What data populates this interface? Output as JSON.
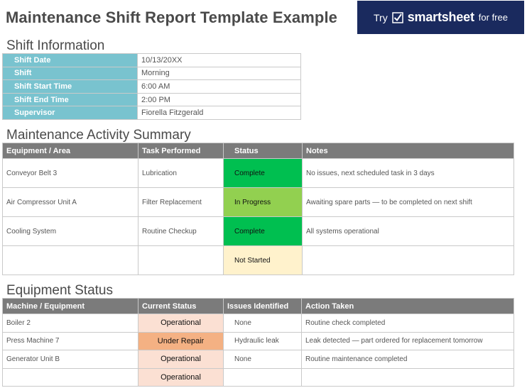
{
  "header": {
    "title": "Maintenance Shift Report Template Example",
    "promo_try": "Try",
    "promo_brand": "smartsheet",
    "promo_free": "for free"
  },
  "shift_info": {
    "heading": "Shift Information",
    "rows": [
      {
        "label": "Shift Date",
        "value": "10/13/20XX"
      },
      {
        "label": "Shift",
        "value": "Morning"
      },
      {
        "label": "Shift Start Time",
        "value": "6:00 AM"
      },
      {
        "label": "Shift End Time",
        "value": "2:00 PM"
      },
      {
        "label": "Supervisor",
        "value": "Fiorella Fitzgerald"
      }
    ]
  },
  "activity": {
    "heading": "Maintenance Activity Summary",
    "columns": [
      "Equipment / Area",
      "Task Performed",
      "Status",
      "Notes"
    ],
    "rows": [
      {
        "equipment": "Conveyor Belt 3",
        "task": "Lubrication",
        "status": "Complete",
        "notes": "No issues, next scheduled task in 3 days"
      },
      {
        "equipment": "Air Compressor Unit A",
        "task": "Filter Replacement",
        "status": "In Progress",
        "notes": "Awaiting spare parts — to be completed on next shift"
      },
      {
        "equipment": "Cooling System",
        "task": "Routine Checkup",
        "status": "Complete",
        "notes": "All systems operational"
      },
      {
        "equipment": "",
        "task": "",
        "status": "Not Started",
        "notes": ""
      }
    ]
  },
  "equipment": {
    "heading": "Equipment Status",
    "columns": [
      "Machine / Equipment",
      "Current Status",
      "Issues Identified",
      "Action Taken"
    ],
    "rows": [
      {
        "machine": "Boiler 2",
        "status": "Operational",
        "issues": "None",
        "action": "Routine check completed"
      },
      {
        "machine": "Press Machine 7",
        "status": "Under Repair",
        "issues": "Hydraulic leak",
        "action": "Leak detected — part ordered for replacement tomorrow"
      },
      {
        "machine": "Generator Unit B",
        "status": "Operational",
        "issues": "None",
        "action": "Routine maintenance completed"
      },
      {
        "machine": "",
        "status": "Operational",
        "issues": "",
        "action": ""
      }
    ]
  },
  "colors": {
    "label_fill": "#79c3cf",
    "header_fill": "#7b7b7b",
    "complete": "#00bf50",
    "in_progress": "#92d050",
    "not_started": "#fff2cc",
    "operational": "#fbe0d3",
    "under_repair": "#f4b183",
    "promo_bg": "#1a2a5e"
  }
}
